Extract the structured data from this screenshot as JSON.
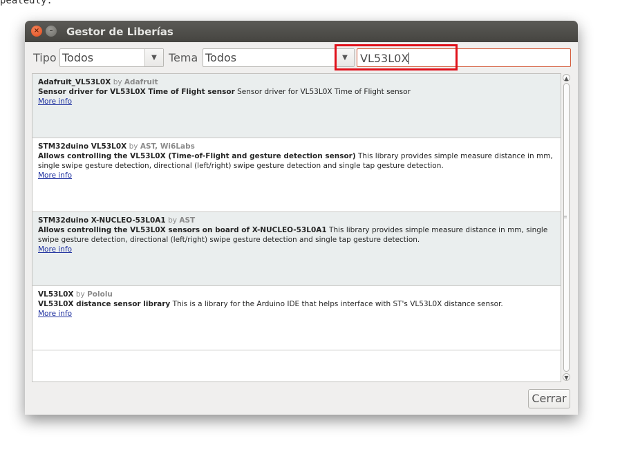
{
  "background_text": "peatedly:",
  "window": {
    "title": "Gestor de Liberías"
  },
  "filters": {
    "tipo_label": "Tipo",
    "tipo_value": "Todos",
    "tema_label": "Tema",
    "tema_value": "Todos",
    "search_value": "VL53L0X"
  },
  "libraries": [
    {
      "name": "Adafruit_VL53L0X",
      "by": "by",
      "author": "Adafruit",
      "sentence": "Sensor driver for VL53L0X Time of Flight sensor",
      "description": "Sensor driver for VL53L0X Time of Flight sensor",
      "more_info": "More info"
    },
    {
      "name": "STM32duino VL53L0X",
      "by": "by",
      "author": "AST, Wi6Labs",
      "sentence": "Allows controlling the VL53L0X (Time-of-Flight and gesture detection sensor)",
      "description": "This library provides simple measure distance in mm, single swipe gesture detection, directional (left/right) swipe gesture detection and single tap gesture detection.",
      "more_info": "More info"
    },
    {
      "name": "STM32duino X-NUCLEO-53L0A1",
      "by": "by",
      "author": "AST",
      "sentence": "Allows controlling the VL53L0X sensors on board of X-NUCLEO-53L0A1",
      "description": "This library provides simple measure distance in mm, single swipe gesture detection, directional (left/right) swipe gesture detection and single tap gesture detection.",
      "more_info": "More info"
    },
    {
      "name": "VL53L0X",
      "by": "by",
      "author": "Pololu",
      "sentence": "VL53L0X distance sensor library",
      "description": "This is a library for the Arduino IDE that helps interface with ST's VL53L0X distance sensor.",
      "more_info": "More info"
    }
  ],
  "buttons": {
    "close_label": "Cerrar"
  },
  "icons": {
    "close": "close-icon",
    "minimize": "minimize-icon",
    "dropdown": "chevron-down-icon"
  },
  "colors": {
    "highlight_border": "#e0101a",
    "titlebar": "#4f4e4a",
    "link": "#1c2e9e"
  }
}
